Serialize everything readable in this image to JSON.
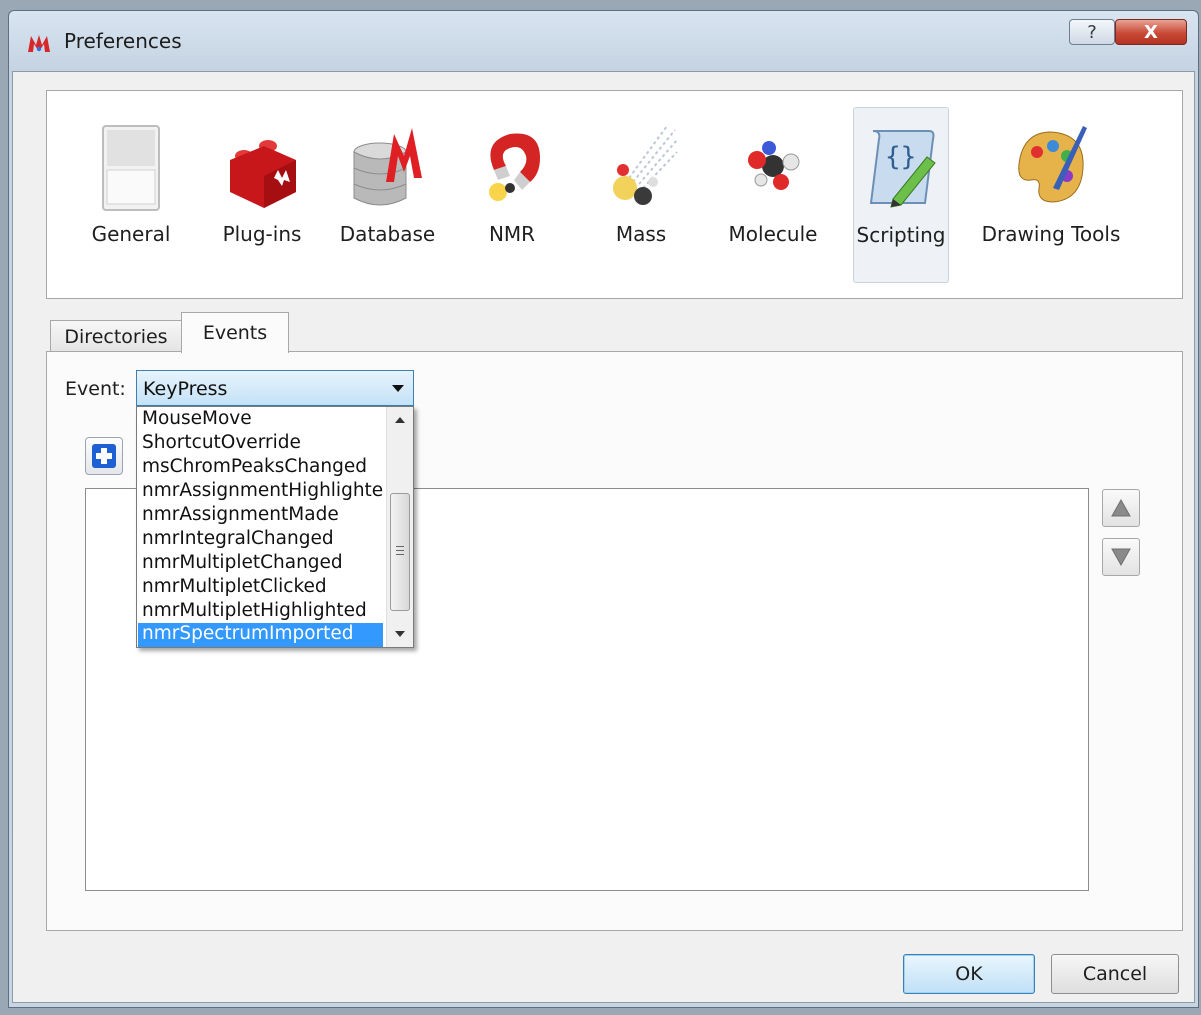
{
  "window": {
    "title": "Preferences",
    "help_label": "?",
    "close_label": "X"
  },
  "categories": [
    {
      "label": "General",
      "icon": "switch-icon"
    },
    {
      "label": "Plug-ins",
      "icon": "lego-brick-icon"
    },
    {
      "label": "Database",
      "icon": "database-icon"
    },
    {
      "label": "NMR",
      "icon": "magnet-icon"
    },
    {
      "label": "Mass",
      "icon": "ion-beam-icon"
    },
    {
      "label": "Molecule",
      "icon": "molecule-icon"
    },
    {
      "label": "Scripting",
      "icon": "script-scroll-icon",
      "selected": true
    },
    {
      "label": "Drawing Tools",
      "icon": "paint-palette-icon"
    }
  ],
  "tabs": [
    {
      "label": "Directories",
      "active": false
    },
    {
      "label": "Events",
      "active": true
    }
  ],
  "event": {
    "label": "Event:",
    "value": "KeyPress",
    "options": [
      "MouseMove",
      "ShortcutOverride",
      "msChromPeaksChanged",
      "nmrAssignmentHighlighted",
      "nmrAssignmentMade",
      "nmrIntegralChanged",
      "nmrMultipletChanged",
      "nmrMultipletClicked",
      "nmrMultipletHighlighted",
      "nmrSpectrumImported"
    ],
    "highlighted_option": "nmrSpectrumImported"
  },
  "buttons": {
    "ok": "OK",
    "cancel": "Cancel"
  },
  "colors": {
    "selection": "#3399ff",
    "combo_focus": "#c4e2f7",
    "close_button": "#c84a37"
  }
}
